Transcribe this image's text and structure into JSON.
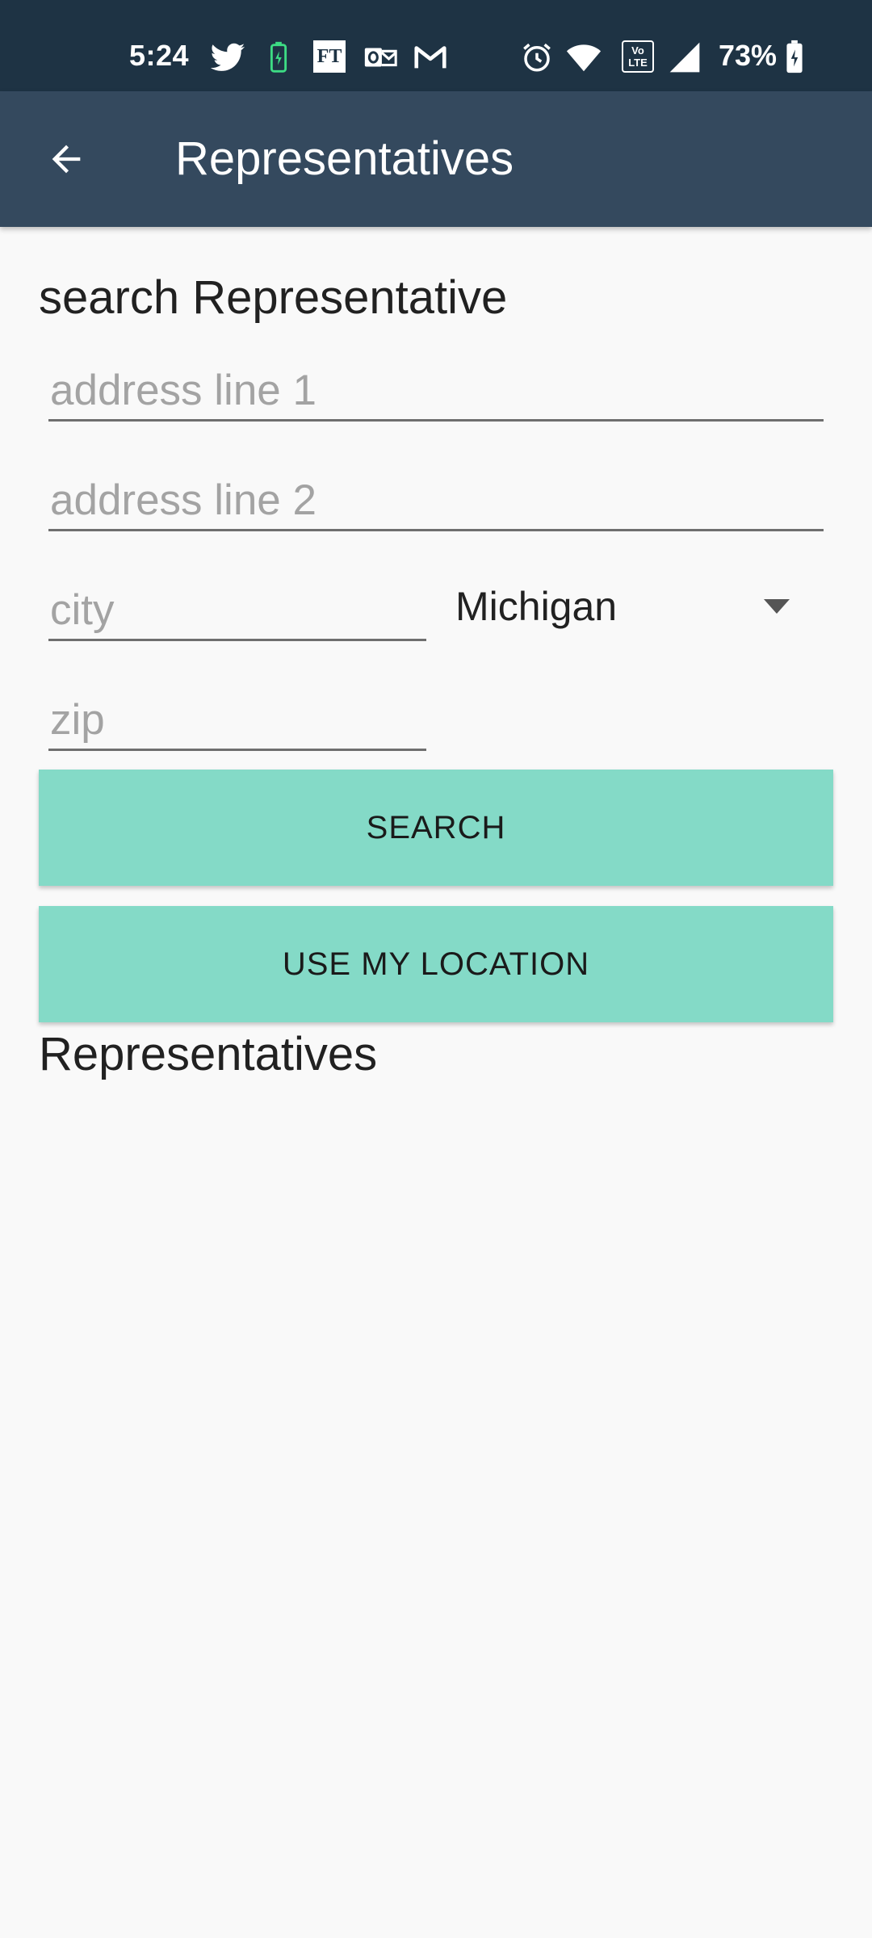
{
  "status_bar": {
    "time": "5:24",
    "battery_percent": "73%",
    "icons": [
      "twitter-icon",
      "battery-saver-icon",
      "ft-icon",
      "outlook-icon",
      "gmail-icon",
      "alarm-icon",
      "wifi-icon",
      "volte-icon",
      "signal-icon",
      "battery-icon"
    ],
    "ft_label": "FT",
    "volte_label": "Vo LTE"
  },
  "app_bar": {
    "title": "Representatives",
    "back_icon": "arrow-back-icon"
  },
  "form": {
    "heading": "search Representative",
    "address_line_1": {
      "value": "",
      "placeholder": "address line 1"
    },
    "address_line_2": {
      "value": "",
      "placeholder": "address line 2"
    },
    "city": {
      "value": "",
      "placeholder": "city"
    },
    "state": {
      "selected": "Michigan"
    },
    "zip": {
      "value": "",
      "placeholder": "zip"
    },
    "search_button": "SEARCH",
    "location_button": "USE MY LOCATION"
  },
  "results": {
    "heading": "Representatives"
  },
  "colors": {
    "status_bar": "#1e3344",
    "app_bar": "#34495e",
    "button": "#84dac7",
    "background": "#f9f9f9"
  }
}
